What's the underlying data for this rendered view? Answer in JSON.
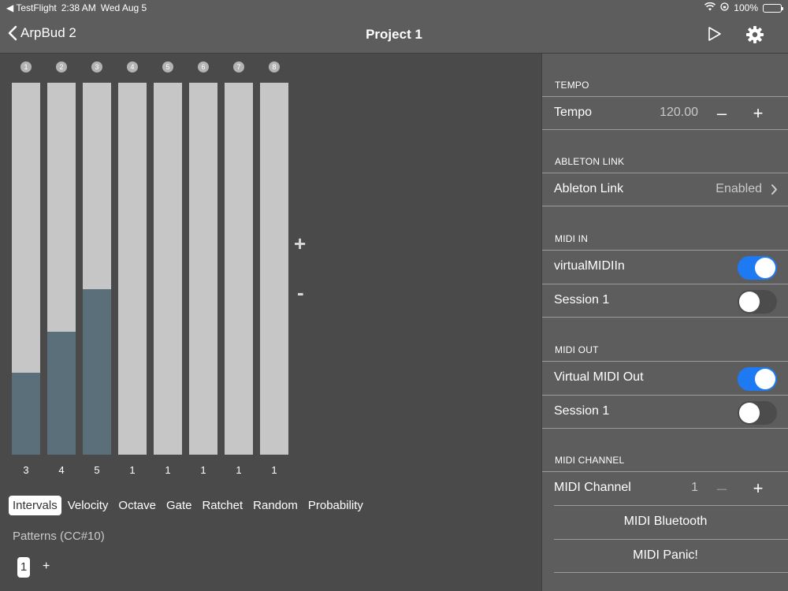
{
  "status_bar": {
    "back_app": "◀ TestFlight",
    "time": "2:38 AM",
    "date": "Wed Aug 5",
    "battery": "100%"
  },
  "navbar": {
    "back_label": "ArpBud 2",
    "title": "Project 1",
    "play_icon": "play-icon",
    "settings_icon": "gear-icon"
  },
  "steps": [
    {
      "index": "1",
      "value": "3",
      "level": 0.22
    },
    {
      "index": "2",
      "value": "4",
      "level": 0.33
    },
    {
      "index": "3",
      "value": "5",
      "level": 0.445
    },
    {
      "index": "4",
      "value": "1",
      "level": 0
    },
    {
      "index": "5",
      "value": "1",
      "level": 0
    },
    {
      "index": "6",
      "value": "1",
      "level": 0
    },
    {
      "index": "7",
      "value": "1",
      "level": 0
    },
    {
      "index": "8",
      "value": "1",
      "level": 0
    }
  ],
  "step_controls": {
    "plus": "+",
    "minus": "-"
  },
  "tabs": [
    {
      "label": "Intervals",
      "active": true
    },
    {
      "label": "Velocity"
    },
    {
      "label": "Octave"
    },
    {
      "label": "Gate"
    },
    {
      "label": "Ratchet"
    },
    {
      "label": "Random"
    },
    {
      "label": "Probability"
    }
  ],
  "patterns": {
    "label": "Patterns (CC#10)",
    "items": [
      "1"
    ],
    "add": "+"
  },
  "panel": {
    "tempo": {
      "header": "TEMPO",
      "label": "Tempo",
      "value": "120.00",
      "minus": "–",
      "plus": "+"
    },
    "link": {
      "header": "ABLETON LINK",
      "label": "Ableton Link",
      "value": "Enabled"
    },
    "midi_in": {
      "header": "MIDI IN",
      "items": [
        {
          "label": "virtualMIDIIn",
          "on": true
        },
        {
          "label": "Session 1",
          "on": false
        }
      ]
    },
    "midi_out": {
      "header": "MIDI OUT",
      "items": [
        {
          "label": "Virtual MIDI Out",
          "on": true
        },
        {
          "label": "Session 1",
          "on": false
        }
      ]
    },
    "midi_channel": {
      "header": "MIDI CHANNEL",
      "label": "MIDI Channel",
      "value": "1",
      "minus": "–",
      "plus": "+"
    },
    "bluetooth_label": "MIDI Bluetooth",
    "panic_label": "MIDI Panic!"
  },
  "colors": {
    "toggle_on": "#1d7af3",
    "step_fill": "#5a6f79",
    "step_bg": "#c6c6c6"
  }
}
